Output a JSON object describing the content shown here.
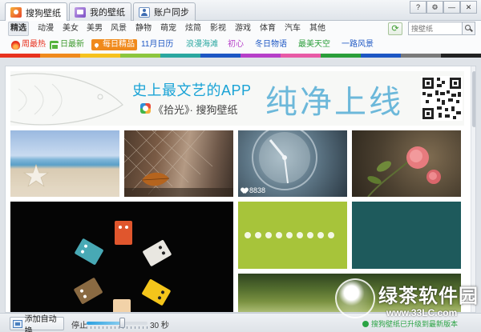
{
  "top_tabs": [
    {
      "label": "搜狗壁纸",
      "icon": "sogou-logo-icon",
      "active": true
    },
    {
      "label": "我的壁纸",
      "icon": "my-wallpaper-icon",
      "active": false
    },
    {
      "label": "账户同步",
      "icon": "user-account-icon",
      "active": false
    }
  ],
  "window_controls": {
    "help": "?",
    "settings": "⚙",
    "minimize": "—",
    "close": "✕"
  },
  "categories": [
    "精选",
    "动漫",
    "美女",
    "美男",
    "风景",
    "静物",
    "萌宠",
    "炫简",
    "影视",
    "游戏",
    "体育",
    "汽车",
    "其他"
  ],
  "active_category": "精选",
  "search": {
    "placeholder": "搜壁纸"
  },
  "topics": [
    {
      "label": "周最热",
      "color": "#e8321e",
      "icon": "flame-icon"
    },
    {
      "label": "日最新",
      "color": "#3f9b2f",
      "icon": "calendar-icon"
    },
    {
      "label": "每日精品",
      "color": "#ffffff",
      "bg": "#f08a1c",
      "icon": "pick-icon"
    },
    {
      "label": "11月日历",
      "color": "#1d57c4"
    },
    {
      "label": "浪漫海滩",
      "color": "#2aa7a0"
    },
    {
      "label": "初心",
      "color": "#b63fc9"
    },
    {
      "label": "冬日物语",
      "color": "#1d57c4"
    },
    {
      "label": "最美天空",
      "color": "#2a9e3a"
    },
    {
      "label": "一路风景",
      "color": "#1d57c4"
    }
  ],
  "color_strip": [
    "#e8321e",
    "#f08a1c",
    "#f6c21e",
    "#8cc63f",
    "#2aa7a0",
    "#1d57c4",
    "#b63fc9",
    "#e85aa6",
    "#2a9e3a",
    "#1d57c4",
    "#7a7a7a",
    "#222222"
  ],
  "banner": {
    "headline": "史上最文艺的APP",
    "subtitle": "《拾光》· 搜狗壁纸",
    "big_text": "纯净上线"
  },
  "thumbnails": [
    {
      "name": "starfish-beach"
    },
    {
      "name": "autumn-leaf-fence"
    },
    {
      "name": "clock",
      "likes": "8838"
    },
    {
      "name": "pink-roses"
    },
    {
      "name": "guitar-pedals-circle"
    },
    {
      "name": "green-dots"
    },
    {
      "name": "teal-solid"
    },
    {
      "name": "green-grass"
    }
  ],
  "bottom": {
    "auto_change": "添加自动换",
    "stop": "停止",
    "seconds": "30 秒",
    "slider_fraction": 0.6,
    "status": "搜狗壁纸已升级到最新版本"
  },
  "watermark": {
    "text": "绿茶软件园",
    "url": "www.33LC.com"
  }
}
